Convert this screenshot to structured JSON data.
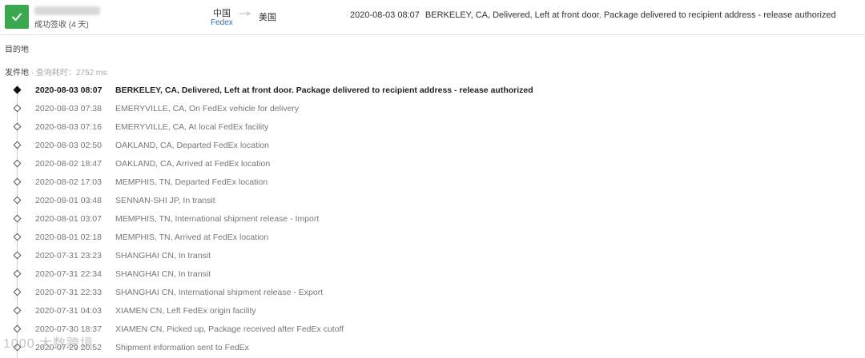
{
  "header": {
    "status_icon": "check-icon",
    "status_color": "#3aa84f",
    "status_label": "成功签收 (4 天)",
    "origin_country": "中国",
    "carrier": "Fedex",
    "destination_country": "美国",
    "latest_time": "2020-08-03 08:07",
    "latest_message": "BERKELEY, CA, Delivered, Left at front door. Package delivered to recipient address - release authorized"
  },
  "labels": {
    "destination": "目的地",
    "origin": "发件地",
    "query_time": " · 查询耗时：2752 ms"
  },
  "events": [
    {
      "time": "2020-08-03 08:07",
      "message": "BERKELEY, CA, Delivered, Left at front door. Package delivered to recipient address - release authorized"
    },
    {
      "time": "2020-08-03 07:38",
      "message": "EMERYVILLE, CA, On FedEx vehicle for delivery"
    },
    {
      "time": "2020-08-03 07:16",
      "message": "EMERYVILLE, CA, At local FedEx facility"
    },
    {
      "time": "2020-08-03 02:50",
      "message": "OAKLAND, CA, Departed FedEx location"
    },
    {
      "time": "2020-08-02 18:47",
      "message": "OAKLAND, CA, Arrived at FedEx location"
    },
    {
      "time": "2020-08-02 17:03",
      "message": "MEMPHIS, TN, Departed FedEx location"
    },
    {
      "time": "2020-08-01 03:48",
      "message": "SENNAN-SHI JP, In transit"
    },
    {
      "time": "2020-08-01 03:07",
      "message": "MEMPHIS, TN, International shipment release - Import"
    },
    {
      "time": "2020-08-01 02:18",
      "message": "MEMPHIS, TN, Arrived at FedEx location"
    },
    {
      "time": "2020-07-31 23:23",
      "message": "SHANGHAI CN, In transit"
    },
    {
      "time": "2020-07-31 22:34",
      "message": "SHANGHAI CN, In transit"
    },
    {
      "time": "2020-07-31 22:33",
      "message": "SHANGHAI CN, International shipment release - Export"
    },
    {
      "time": "2020-07-31 04:03",
      "message": "XIAMEN CN, Left FedEx origin facility"
    },
    {
      "time": "2020-07-30 18:37",
      "message": "XIAMEN CN, Picked up, Package received after FedEx cutoff"
    },
    {
      "time": "2020-07-29 20:52",
      "message": "Shipment information sent to FedEx"
    }
  ],
  "watermark": "1000 大数跨境"
}
